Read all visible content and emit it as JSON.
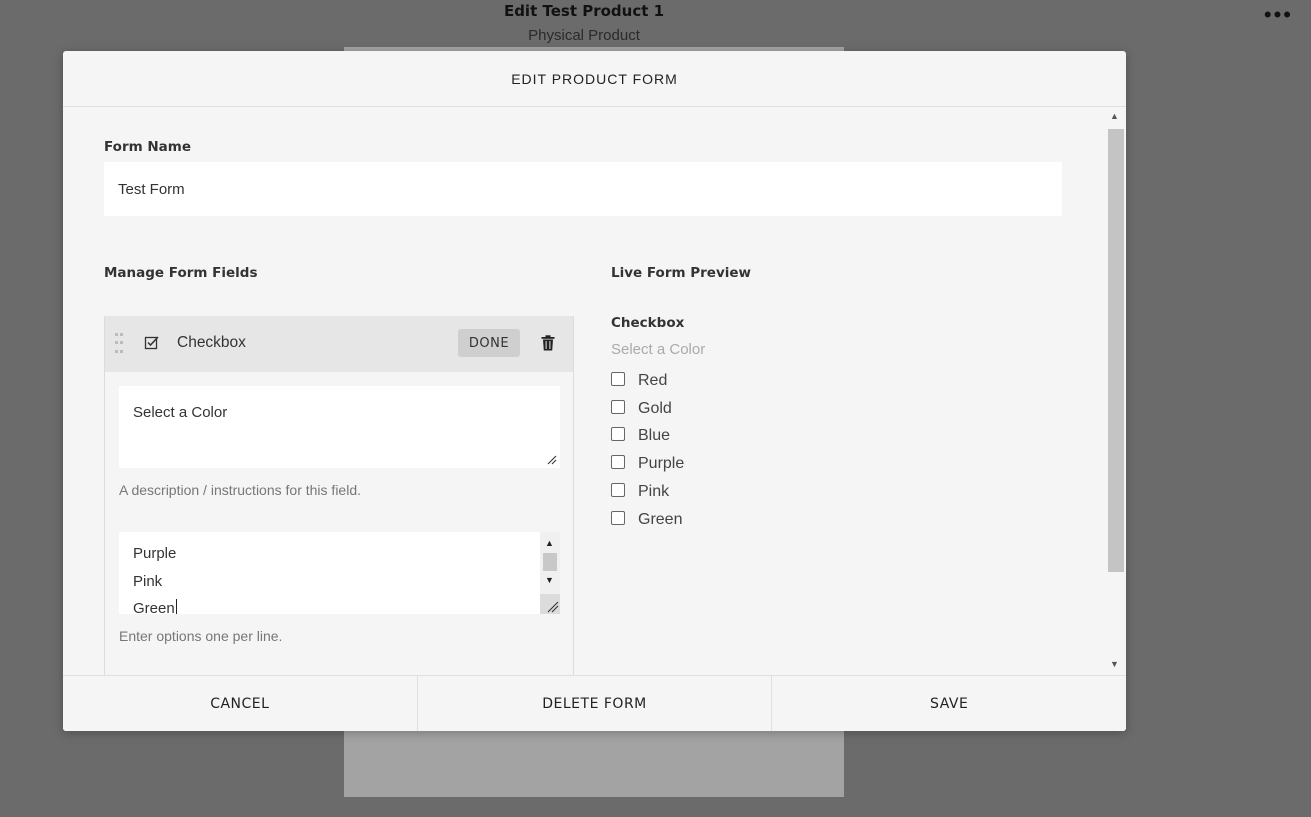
{
  "background": {
    "title": "Edit Test Product 1",
    "subtitle": "Physical Product",
    "more_icon": "more-horizontal-icon"
  },
  "modal": {
    "title": "EDIT PRODUCT FORM",
    "form_name_label": "Form Name",
    "form_name_value": "Test Form",
    "manage_label": "Manage Form Fields",
    "preview_label": "Live Form Preview"
  },
  "field": {
    "type": "Checkbox",
    "done_label": "DONE",
    "description_value": "Select a Color",
    "description_hint": "A description / instructions for this field.",
    "options_visible": [
      "Purple",
      "Pink",
      "Green"
    ],
    "options_hint": "Enter options one per line."
  },
  "preview": {
    "field_label": "Checkbox",
    "field_description": "Select a Color",
    "options": [
      "Red",
      "Gold",
      "Blue",
      "Purple",
      "Pink",
      "Green"
    ]
  },
  "footer": {
    "cancel_label": "CANCEL",
    "delete_label": "DELETE FORM",
    "save_label": "SAVE"
  }
}
